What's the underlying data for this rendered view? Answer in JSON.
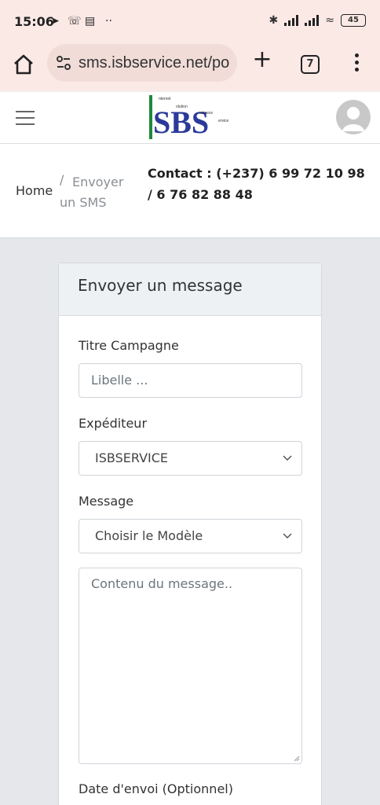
{
  "status": {
    "time": "15:06",
    "battery": "45"
  },
  "browser": {
    "url": "sms.isbservice.net/po",
    "tab_count": "7"
  },
  "header": {
    "logo_texts": [
      "nternet",
      "olution",
      "usiness",
      "ervice"
    ]
  },
  "breadcrumb": {
    "home": "Home",
    "separator": "/",
    "current": "Envoyer un SMS"
  },
  "contact": "Contact : (+237) 6 99 72 10 98 / 6 76 82 88 48",
  "form": {
    "title": "Envoyer un message",
    "campaign_label": "Titre Campagne",
    "campaign_placeholder": "Libelle ...",
    "sender_label": "Expéditeur",
    "sender_value": "ISBSERVICE",
    "message_label": "Message",
    "template_value": "Choisir le Modèle",
    "content_placeholder": "Contenu du message..",
    "date_label": "Date d'envoi (Optionnel)"
  },
  "colors": {
    "chrome_bg": "#fbe9e6",
    "logo_blue": "#2b3a9a",
    "logo_green": "#1d8a3a"
  }
}
